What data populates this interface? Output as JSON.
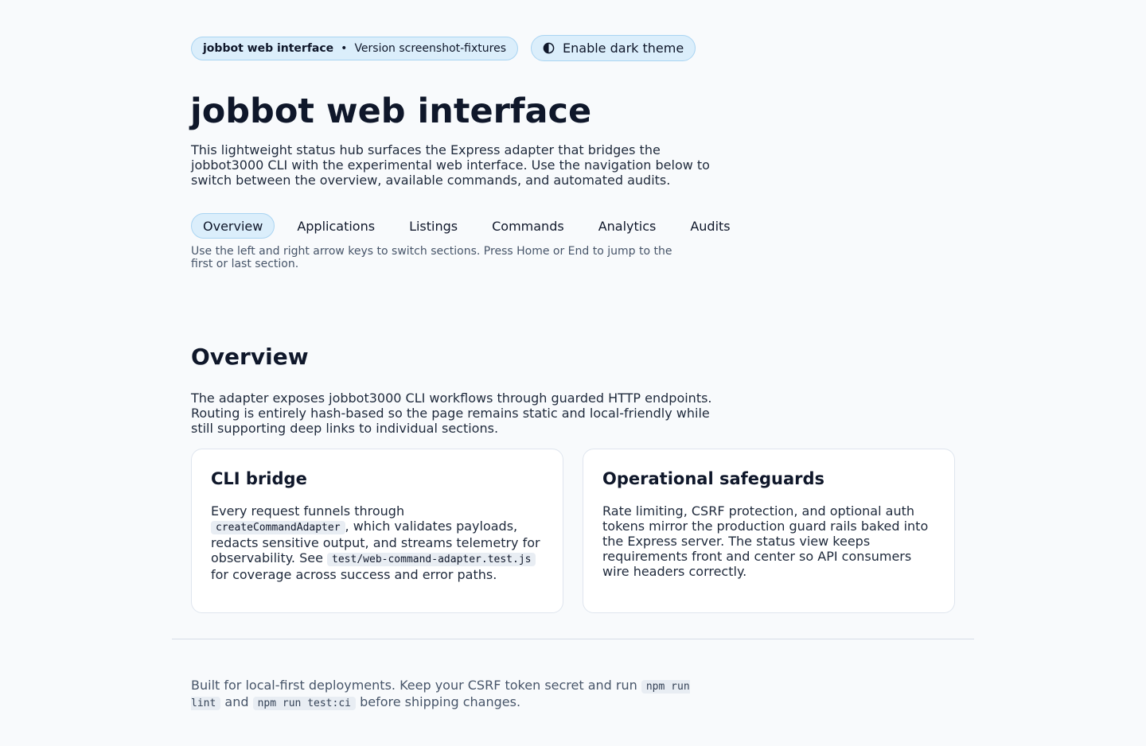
{
  "header": {
    "app_name": "jobbot web interface",
    "separator": "•",
    "version_label": "Version screenshot-fixtures",
    "theme_toggle_label": "Enable dark theme"
  },
  "hero": {
    "title": "jobbot web interface",
    "description": "This lightweight status hub surfaces the Express adapter that bridges the jobbot3000 CLI with the experimental web interface. Use the navigation below to switch between the overview, available commands, and automated audits."
  },
  "nav": {
    "tabs": [
      {
        "label": "Overview",
        "active": true
      },
      {
        "label": "Applications",
        "active": false
      },
      {
        "label": "Listings",
        "active": false
      },
      {
        "label": "Commands",
        "active": false
      },
      {
        "label": "Analytics",
        "active": false
      },
      {
        "label": "Audits",
        "active": false
      }
    ],
    "hint": "Use the left and right arrow keys to switch sections. Press Home or End to jump to the first or last section."
  },
  "overview": {
    "title": "Overview",
    "description": "The adapter exposes jobbot3000 CLI workflows through guarded HTTP endpoints. Routing is entirely hash-based so the page remains static and local-friendly while still supporting deep links to individual sections.",
    "cards": [
      {
        "title": "CLI bridge",
        "text_before": "Every request funnels through ",
        "code_1": "createCommandAdapter",
        "text_middle": ", which validates payloads, redacts sensitive output, and streams telemetry for observability. See ",
        "code_2": "test/web-command-adapter.test.js",
        "text_after": " for coverage across success and error paths."
      },
      {
        "title": "Operational safeguards",
        "text": "Rate limiting, CSRF protection, and optional auth tokens mirror the production guard rails baked into the Express server. The status view keeps requirements front and center so API consumers wire headers correctly."
      }
    ]
  },
  "footer": {
    "text_before": "Built for local-first deployments. Keep your CSRF token secret and run ",
    "code_1": "npm run lint",
    "text_middle": " and ",
    "code_2": "npm run test:ci",
    "text_after": " before shipping changes."
  },
  "colors": {
    "pill_bg": "#dbeefb",
    "pill_border": "#a9d4f2",
    "text_primary": "#0f172a",
    "text_muted": "#475569"
  },
  "icons": {
    "theme_toggle": "contrast-icon"
  }
}
